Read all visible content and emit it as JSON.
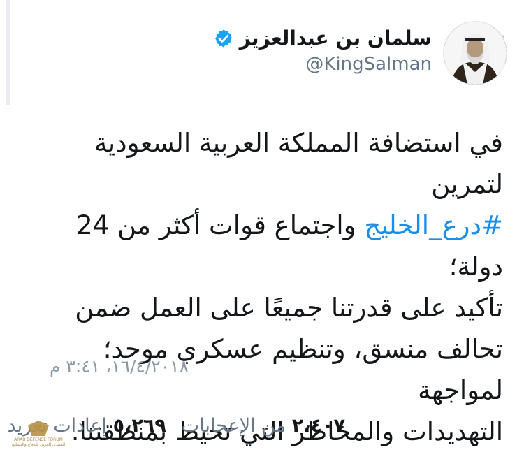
{
  "author": {
    "name": "سلمان بن عبدالعزيز",
    "handle": "@KingSalman",
    "verified": true
  },
  "tweet": {
    "lines": [
      "في استضافة المملكة العربية السعودية لتمرين",
      "واجتماع قوات أكثر من 24 دولة؛",
      "تأكيد على قدرتنا جميعًا على العمل ضمن",
      "تحالف منسق، وتنظيم عسكري موحد؛ لمواجهة",
      "التهديدات والمخاطر التي تحيط بمنطقتنا."
    ],
    "hashtag": "#درع_الخليج"
  },
  "timestamp": "١٦/٤/٢٠١٨، ٣:٤١ م",
  "stats": {
    "retweets_count": "٢،٤٠٧",
    "retweets_label": "من الإعجابات",
    "likes_count": "٥،٢٦٩",
    "likes_label": "إعادات تغريد"
  },
  "watermark": {
    "line1": "ARAB DEFENSE FORUM",
    "line2": "المنتدى العربي للدفاع والتسليح"
  },
  "icons": {
    "verified": "verified-badge-icon",
    "caret": "chevron-down-icon"
  },
  "colors": {
    "hashtag": "#1d8ee8",
    "verified": "#1da1f2",
    "muted": "#657786"
  }
}
